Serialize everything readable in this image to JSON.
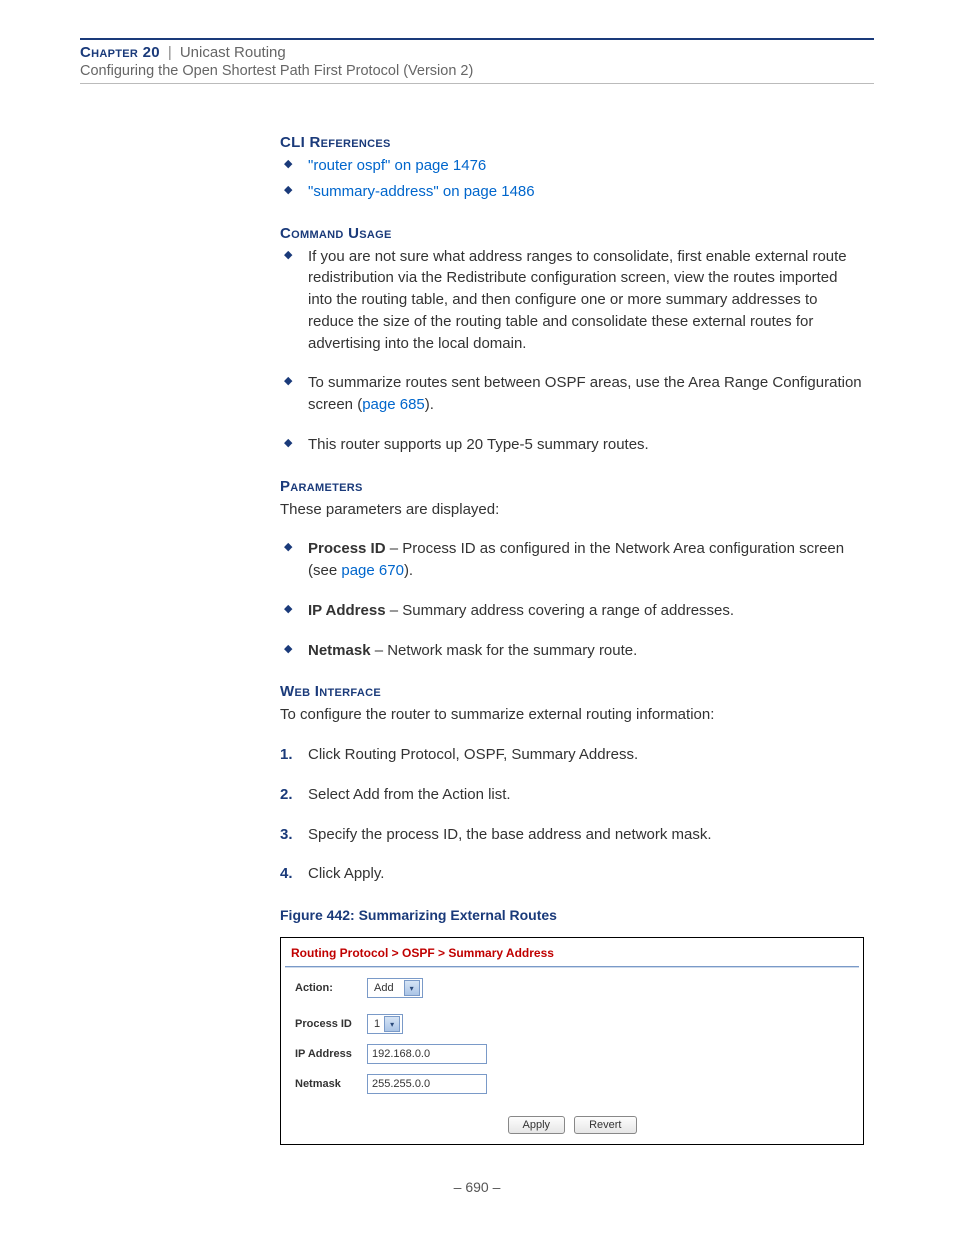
{
  "header": {
    "chapter_label": "Chapter 20",
    "sep": "|",
    "chapter_title": "Unicast Routing",
    "subtitle": "Configuring the Open Shortest Path First Protocol (Version 2)"
  },
  "sections": {
    "cli_references": {
      "heading": "CLI References",
      "items": [
        {
          "text": "\"router ospf\" on page 1476"
        },
        {
          "text": "\"summary-address\" on page 1486"
        }
      ]
    },
    "command_usage": {
      "heading": "Command Usage",
      "items": [
        {
          "plain": "If you are not sure what address ranges to consolidate, first enable external route redistribution via the Redistribute configuration screen, view the routes imported into the routing table, and then configure one or more summary addresses to reduce the size of the routing table and consolidate these external routes for advertising into the local domain."
        },
        {
          "pre": "To summarize routes sent between OSPF areas, use the Area Range Configuration screen (",
          "link": "page 685",
          "post": ")."
        },
        {
          "plain": "This router supports up 20 Type-5 summary routes."
        }
      ]
    },
    "parameters": {
      "heading": "Parameters",
      "intro": "These parameters are displayed:",
      "items": [
        {
          "bold": "Process ID",
          "pre": " – Process ID as configured in the Network Area configuration screen (see ",
          "link": "page 670",
          "post": ")."
        },
        {
          "bold": "IP Address",
          "plain": " – Summary address covering a range of addresses."
        },
        {
          "bold": "Netmask",
          "plain": " – Network mask for the summary route."
        }
      ]
    },
    "web_interface": {
      "heading": "Web Interface",
      "intro": "To configure the router to summarize external routing information:",
      "steps": [
        "Click Routing Protocol, OSPF, Summary Address.",
        "Select Add from the Action list.",
        "Specify the process ID, the base address and network mask.",
        "Click Apply."
      ]
    }
  },
  "figure": {
    "caption": "Figure 442:  Summarizing External Routes",
    "breadcrumb": "Routing Protocol > OSPF > Summary Address",
    "action_label": "Action:",
    "action_value": "Add",
    "rows": {
      "process_id": {
        "label": "Process ID",
        "value": "1"
      },
      "ip_address": {
        "label": "IP Address",
        "value": "192.168.0.0"
      },
      "netmask": {
        "label": "Netmask",
        "value": "255.255.0.0"
      }
    },
    "buttons": {
      "apply": "Apply",
      "revert": "Revert"
    }
  },
  "footer": {
    "page_number": "–  690  –"
  }
}
